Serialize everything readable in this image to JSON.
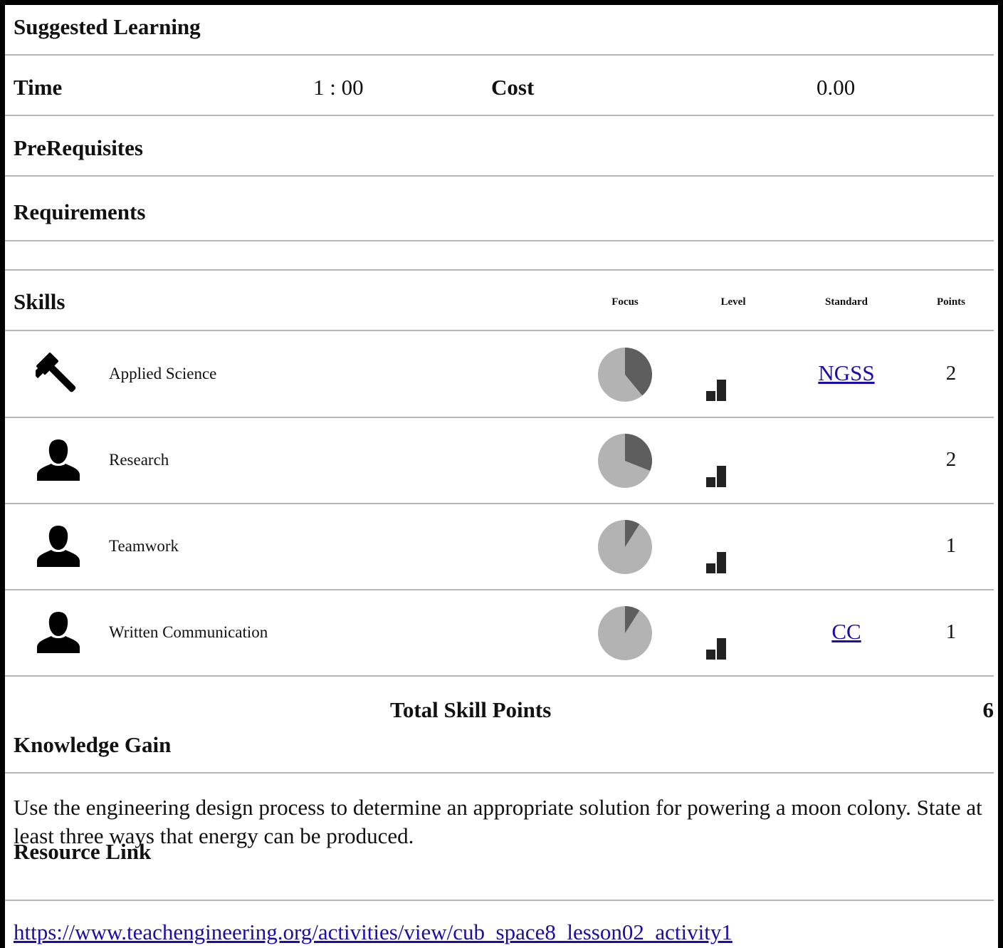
{
  "suggested_learning": {
    "title": "Suggested Learning"
  },
  "time": {
    "label": "Time",
    "value": "1 : 00"
  },
  "cost": {
    "label": "Cost",
    "value": "0.00"
  },
  "prerequisites": {
    "label": "PreRequisites"
  },
  "requirements": {
    "label": "Requirements"
  },
  "skills": {
    "label": "Skills",
    "columns": {
      "focus": "Focus",
      "level": "Level",
      "standard": "Standard",
      "points": "Points"
    },
    "rows": [
      {
        "icon": "hammer-icon",
        "name": "Applied Science",
        "focus": 0.39,
        "level": 1,
        "standard": "NGSS",
        "points": "2"
      },
      {
        "icon": "person-icon",
        "name": "Research",
        "focus": 0.31,
        "level": 1,
        "standard": "",
        "points": "2"
      },
      {
        "icon": "person-icon",
        "name": "Teamwork",
        "focus": 0.09,
        "level": 1,
        "standard": "",
        "points": "1"
      },
      {
        "icon": "person-icon",
        "name": "Written Communication",
        "focus": 0.09,
        "level": 1,
        "standard": "CC",
        "points": "1"
      }
    ],
    "total_label": "Total Skill Points",
    "total_value": "6"
  },
  "knowledge_gain": {
    "label": "Knowledge Gain",
    "text": "Use the engineering design process to determine an appropriate solution for powering a moon colony. State at least three ways that energy can be produced."
  },
  "resource_link": {
    "label": "Resource Link",
    "url": "https://www.teachengineering.org/activities/view/cub_space8_lesson02_activity1"
  },
  "colors": {
    "pie_light": "#b3b3b3",
    "pie_dark": "#5e5e5e",
    "level_bar": "#222222",
    "link": "#1a0dab",
    "rule": "#b7b7b7"
  }
}
